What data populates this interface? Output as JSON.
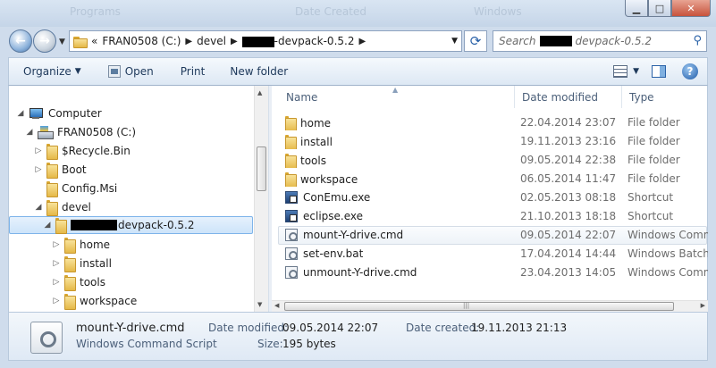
{
  "titlebar": {
    "ghost_texts": [
      "Programs",
      "Date Created",
      "Windows"
    ]
  },
  "address": {
    "chevron": "«",
    "crumbs": [
      "FRAN0508 (C:)",
      "devel",
      "-devpack-0.5.2"
    ],
    "redacted_label": "[redacted]"
  },
  "search": {
    "placeholder_prefix": "Search",
    "placeholder_suffix": "devpack-0.5.2"
  },
  "toolbar": {
    "organize": "Organize",
    "open": "Open",
    "print": "Print",
    "new_folder": "New folder",
    "help": "?"
  },
  "nav_tree": [
    {
      "label": "Computer",
      "icon": "computer-icon",
      "expanded": true
    },
    {
      "label": "FRAN0508 (C:)",
      "icon": "drive-icon",
      "expanded": true
    },
    {
      "label": "$Recycle.Bin",
      "icon": "folder-icon",
      "expanded": false
    },
    {
      "label": "Boot",
      "icon": "folder-icon",
      "expanded": false
    },
    {
      "label": "Config.Msi",
      "icon": "folder-icon",
      "expanded": false
    },
    {
      "label": "devel",
      "icon": "folder-icon",
      "expanded": true
    },
    {
      "label": "devpack-0.5.2",
      "icon": "folder-icon",
      "expanded": true,
      "selected": true
    },
    {
      "label": "home",
      "icon": "folder-icon",
      "expanded": false
    },
    {
      "label": "install",
      "icon": "folder-icon",
      "expanded": false
    },
    {
      "label": "tools",
      "icon": "folder-icon",
      "expanded": false
    },
    {
      "label": "workspace",
      "icon": "folder-icon",
      "expanded": false
    }
  ],
  "columns": {
    "name": "Name",
    "date": "Date modified",
    "type": "Type"
  },
  "files": [
    {
      "name": "home",
      "date": "22.04.2014 23:07",
      "type": "File folder",
      "icon": "folder-icon"
    },
    {
      "name": "install",
      "date": "19.11.2013 23:16",
      "type": "File folder",
      "icon": "folder-icon"
    },
    {
      "name": "tools",
      "date": "09.05.2014 22:38",
      "type": "File folder",
      "icon": "folder-icon"
    },
    {
      "name": "workspace",
      "date": "06.05.2014 11:47",
      "type": "File folder",
      "icon": "folder-icon"
    },
    {
      "name": "ConEmu.exe",
      "date": "02.05.2013 08:18",
      "type": "Shortcut",
      "icon": "shortcut-icon"
    },
    {
      "name": "eclipse.exe",
      "date": "21.10.2013 18:18",
      "type": "Shortcut",
      "icon": "shortcut-icon"
    },
    {
      "name": "mount-Y-drive.cmd",
      "date": "09.05.2014 22:07",
      "type": "Windows Comma",
      "icon": "script-icon",
      "hover": true
    },
    {
      "name": "set-env.bat",
      "date": "17.04.2014 14:44",
      "type": "Windows Batch File",
      "icon": "script-icon"
    },
    {
      "name": "unmount-Y-drive.cmd",
      "date": "23.04.2013 14:05",
      "type": "Windows Comma",
      "icon": "script-icon"
    }
  ],
  "details": {
    "filename": "mount-Y-drive.cmd",
    "filetype": "Windows Command Script",
    "modified_label": "Date modified:",
    "modified_value": "09.05.2014 22:07",
    "created_label": "Date created:",
    "created_value": "19.11.2013 21:13",
    "size_label": "Size:",
    "size_value": "195 bytes"
  }
}
